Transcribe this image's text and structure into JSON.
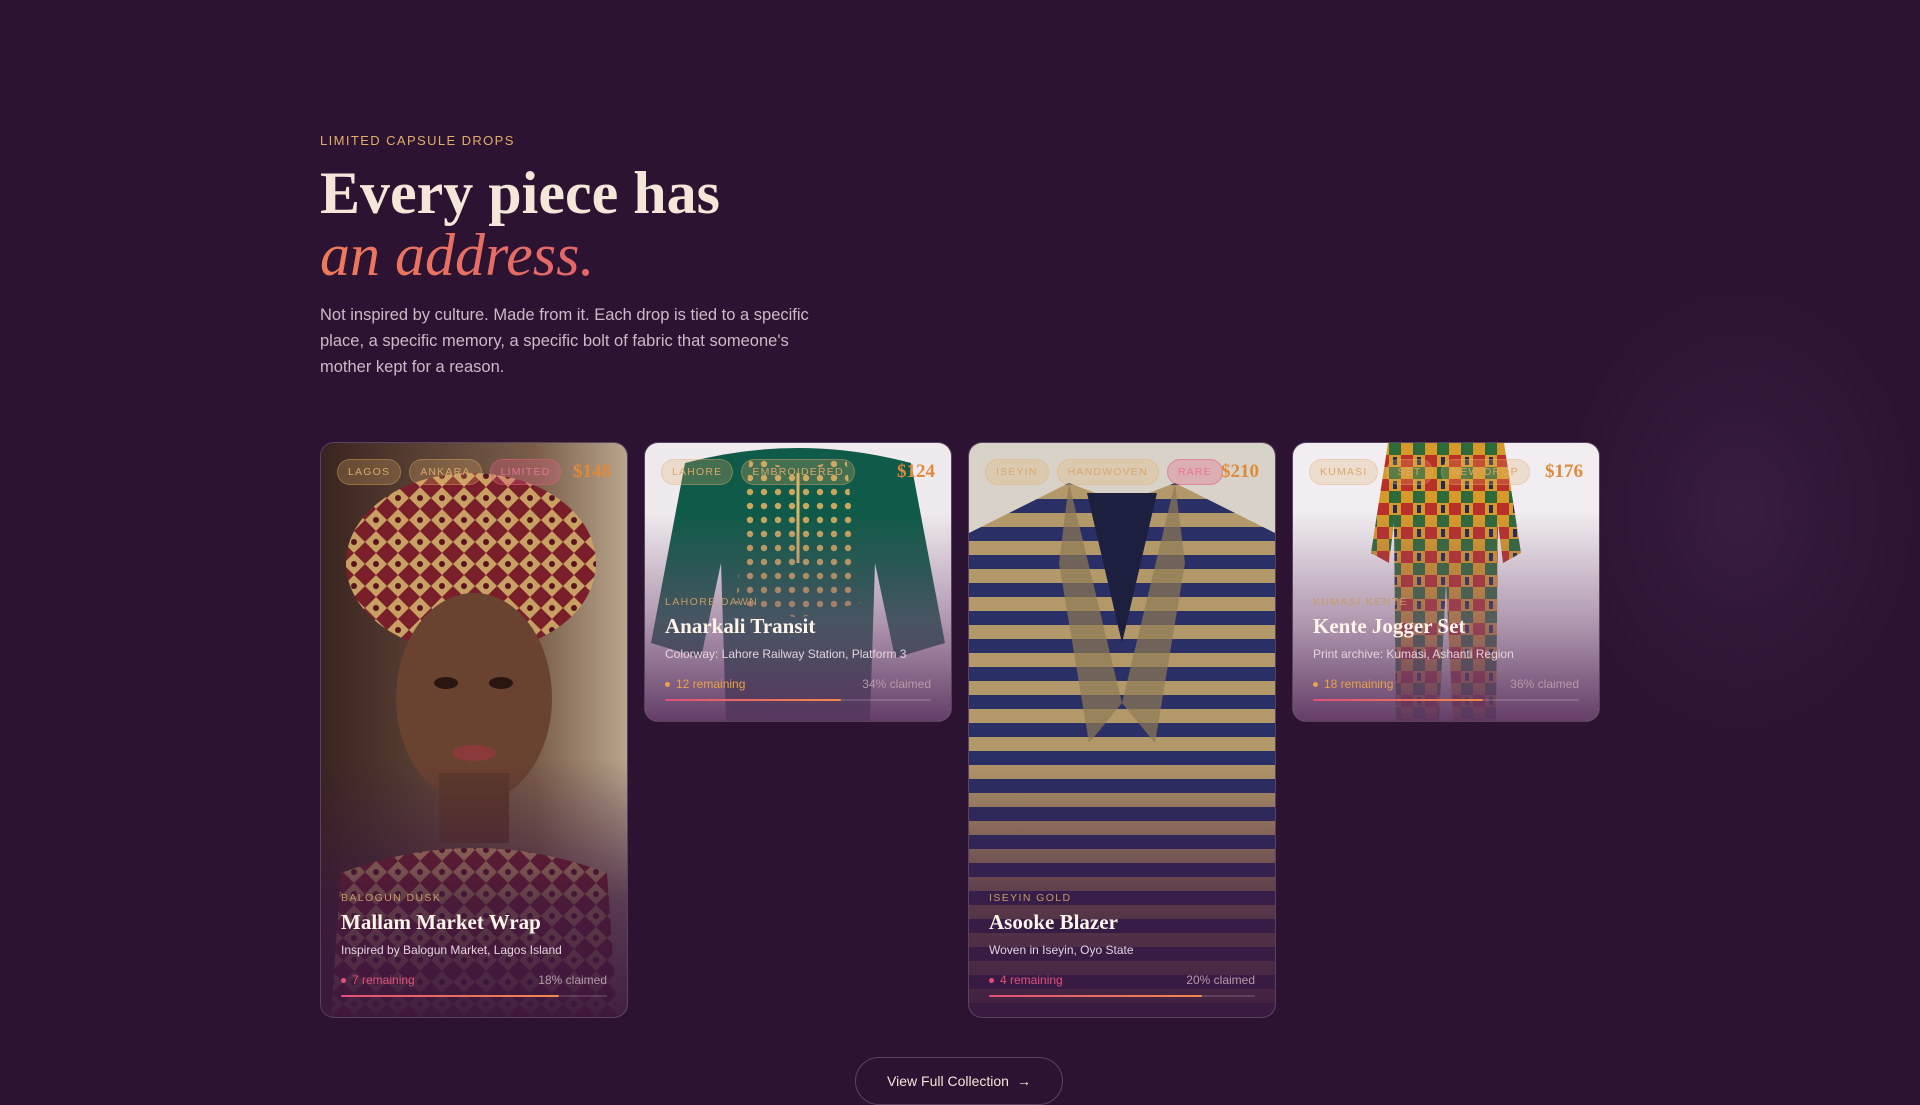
{
  "hero": {
    "eyebrow": "LIMITED CAPSULE DROPS",
    "headline": "Every piece has",
    "headline_accent": "an address.",
    "lede": "Not inspired by culture. Made from it. Each drop is tied to a specific place, a specific memory, a specific bolt of fabric that someone's mother kept for a reason."
  },
  "cards": [
    {
      "tags": [
        "LAGOS",
        "ANKARA",
        "LIMITED"
      ],
      "price": "$148",
      "origin": "BALOGUN DUSK",
      "name": "Mallam Market Wrap",
      "desc": "Inspired by Balogun Market, Lagos Island",
      "remaining": "7 remaining",
      "claimed": "18% claimed",
      "claimed_fraction": 0.18
    },
    {
      "tags": [
        "LAHORE",
        "EMBROIDERED"
      ],
      "price": "$124",
      "origin": "LAHORE DAWN",
      "name": "Anarkali Transit",
      "desc": "Colorway: Lahore Railway Station, Platform 3",
      "remaining": "12 remaining",
      "claimed": "34% claimed",
      "claimed_fraction": 0.34
    },
    {
      "tags": [
        "ISEYIN",
        "HANDWOVEN",
        "RARE"
      ],
      "price": "$210",
      "origin": "ISEYIN GOLD",
      "name": "Asooke Blazer",
      "desc": "Woven in Iseyin, Oyo State",
      "remaining": "4 remaining",
      "claimed": "20% claimed",
      "claimed_fraction": 0.2
    },
    {
      "tags": [
        "KUMASI",
        "SET",
        "NEW DROP"
      ],
      "price": "$176",
      "origin": "KUMASI KENTE",
      "name": "Kente Jogger Set",
      "desc": "Print archive: Kumasi, Ashanti Region",
      "remaining": "18 remaining",
      "claimed": "36% claimed",
      "claimed_fraction": 0.36
    }
  ],
  "cta": {
    "label": "View Full Collection",
    "arrow": "→"
  },
  "colors": {
    "background": "#2b1331",
    "eyebrow": "#e2ae68",
    "accent_pink": "#e24f7c",
    "accent_orange": "#f08a4b",
    "price": "#e08a3c"
  }
}
